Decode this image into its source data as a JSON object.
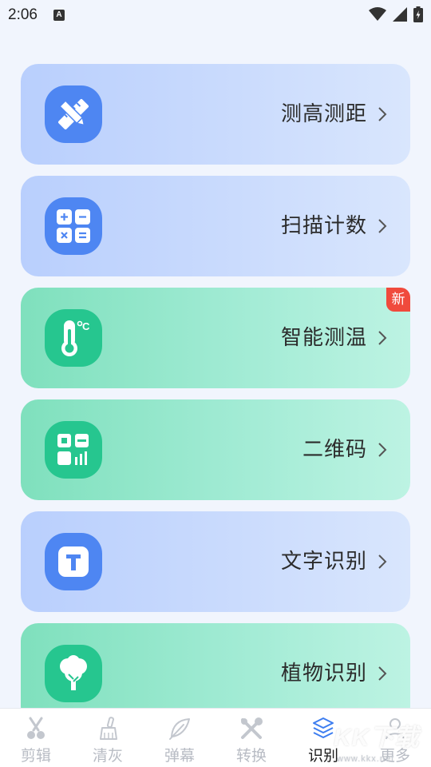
{
  "status_bar": {
    "time": "2:06",
    "notification_icon": "a-letter-icon",
    "icons": [
      "wifi-icon",
      "signal-icon",
      "battery-charging-icon"
    ]
  },
  "cards": [
    {
      "label": "测高测距",
      "icon": "ruler-pencil-icon",
      "theme": "blue",
      "badge": null
    },
    {
      "label": "扫描计数",
      "icon": "calculator-icon",
      "theme": "blue",
      "badge": null
    },
    {
      "label": "智能测温",
      "icon": "thermometer-icon",
      "theme": "green",
      "badge": "新"
    },
    {
      "label": "二维码",
      "icon": "qr-code-icon",
      "theme": "green",
      "badge": null
    },
    {
      "label": "文字识别",
      "icon": "text-t-icon",
      "theme": "blue",
      "badge": null
    },
    {
      "label": "植物识别",
      "icon": "tree-icon",
      "theme": "green",
      "badge": null
    }
  ],
  "bottom_nav": [
    {
      "label": "剪辑",
      "icon": "scissors-icon",
      "active": false
    },
    {
      "label": "清灰",
      "icon": "broom-icon",
      "active": false
    },
    {
      "label": "弹幕",
      "icon": "feather-icon",
      "active": false
    },
    {
      "label": "转换",
      "icon": "tools-icon",
      "active": false
    },
    {
      "label": "识别",
      "icon": "cube-layers-icon",
      "active": true
    },
    {
      "label": "更多",
      "icon": "person-icon",
      "active": false
    }
  ],
  "watermark": {
    "text": "KK下载",
    "url_text": "www.kkx.net"
  },
  "colors": {
    "background": "#f1f5fd",
    "blue_icon": "#4e86f2",
    "green_icon": "#26c68f",
    "badge": "#f04a3c",
    "nav_inactive": "#b8bcc4",
    "nav_active": "#1c1c1c"
  }
}
